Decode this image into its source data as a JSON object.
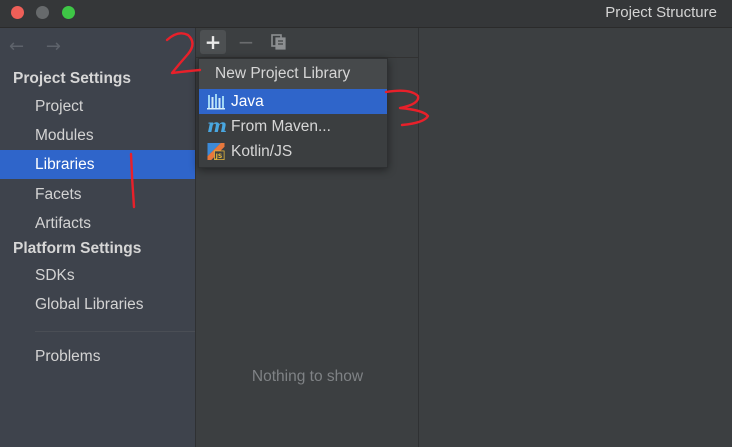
{
  "window": {
    "title": "Project Structure"
  },
  "nav": {
    "back_icon": "←",
    "forward_icon": "→"
  },
  "sidebar": {
    "project_settings_label": "Project Settings",
    "project_settings_items": [
      {
        "label": "Project"
      },
      {
        "label": "Modules"
      },
      {
        "label": "Libraries",
        "selected": true
      },
      {
        "label": "Facets"
      },
      {
        "label": "Artifacts"
      }
    ],
    "platform_settings_label": "Platform Settings",
    "platform_settings_items": [
      {
        "label": "SDKs"
      },
      {
        "label": "Global Libraries"
      }
    ],
    "problems_label": "Problems"
  },
  "toolbar": {
    "add_icon": "+",
    "remove_icon": "−",
    "copy_icon": "copy-icon"
  },
  "middle": {
    "empty_text": "Nothing to show"
  },
  "popup": {
    "header": "New Project Library",
    "items": [
      {
        "label": "Java",
        "icon": "java-library-icon",
        "selected": true
      },
      {
        "label": "From Maven...",
        "icon": "maven-icon"
      },
      {
        "label": "Kotlin/JS",
        "icon": "kotlin-js-icon"
      }
    ]
  },
  "annotations": {
    "color": "#e8202a",
    "numbers": [
      "1",
      "2",
      "3"
    ]
  },
  "colors": {
    "accent": "#2f65ca",
    "sidebar_bg": "#3e434c",
    "panel_bg": "#3c3f41"
  }
}
